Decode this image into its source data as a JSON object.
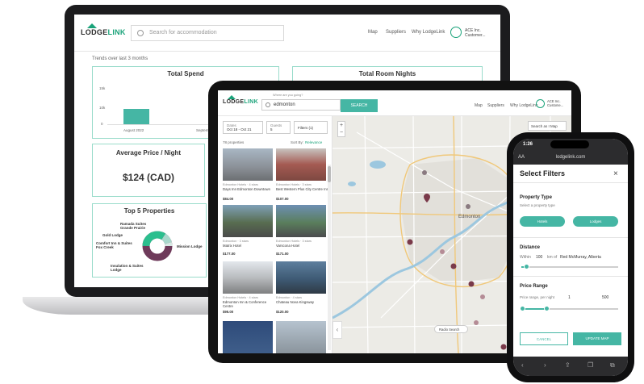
{
  "laptop": {
    "logo": {
      "lodge": "LODGE",
      "link": "LINK"
    },
    "search_placeholder": "Search for accommodation",
    "nav": [
      "Map",
      "Suppliers",
      "Why LodgeLink"
    ],
    "account": {
      "line1": "ACE Inc.",
      "line2": "Customer..."
    },
    "subtitle": "Trends over last 3 months",
    "total_spend": {
      "title": "Total Spend",
      "y_ticks": [
        "15k",
        "10k",
        "0"
      ],
      "x_labels": [
        "August 2022",
        "September 2022"
      ],
      "values": [
        15000,
        5000
      ]
    },
    "total_room_nights": {
      "title": "Total Room Nights"
    },
    "avg_price": {
      "title": "Average Price / Night",
      "value": "$124 (CAD)"
    },
    "top_properties": {
      "title": "Top 5 Properties",
      "labels": [
        "Ramada Suites Grande Prairie",
        "Gold Lodge",
        "Comfort Inn & Suites Fox Creek",
        "Mission Lodge",
        "Insulation & Suites Lodge"
      ]
    }
  },
  "tablet": {
    "logo": {
      "lodge": "LODGE",
      "link": "LINK"
    },
    "search_label": "Where are you going?",
    "search_value": "edmonton",
    "search_button": "SEARCH",
    "nav": [
      "Map",
      "Suppliers",
      "Why LodgeLink"
    ],
    "account": {
      "line1": "ACE Inc.",
      "line2": "Custome..."
    },
    "filters": {
      "dates_label": "Dates",
      "dates": "Oct 18 - Oct 21",
      "guests_label": "Guests",
      "guests": "5",
      "filter": "Filters (1)"
    },
    "results_count": "78 properties",
    "sort_label": "Sort By:",
    "sort_value": "Relevance",
    "properties": [
      {
        "meta": "Edmonton Hotels · 4 stars",
        "name": "Days Inn Edmonton Downtown",
        "price": "$84.00"
      },
      {
        "meta": "Edmonton Hotels · 3 stars",
        "name": "Best Western Plus City Centre Inn",
        "price": "$107.00"
      },
      {
        "meta": "Edmonton · 3 stars",
        "name": "Matrix Hotel",
        "price": "$177.00"
      },
      {
        "meta": "Edmonton Hotels · 3 stars",
        "name": "Varscona Hotel",
        "price": "$171.00"
      },
      {
        "meta": "Edmonton Hotels · 4 stars",
        "name": "Edmonton Inn & Conference Centre",
        "price": "$95.00"
      },
      {
        "meta": "Edmonton · 4 stars",
        "name": "Chateau Nova Kingsway",
        "price": "$120.00"
      }
    ],
    "map": {
      "toggle": "Search as I Map",
      "radio_search": "Radio Search",
      "zoom_in": "+",
      "zoom_out": "−",
      "city": "Edmonton"
    }
  },
  "phone": {
    "time": "1:26",
    "aa": "AA",
    "url": "lodgelink.com",
    "title": "Select Filters",
    "property_type": {
      "label": "Property Type",
      "sub": "Select a property type",
      "options": [
        "Hotels",
        "Lodges"
      ]
    },
    "distance": {
      "label": "Distance",
      "within": "Within",
      "value": "100",
      "of": "km of",
      "location": "Red McMurray, Alberta"
    },
    "price_range": {
      "label": "Price Range",
      "sub": "Price range, per night",
      "min": "1",
      "max": "500"
    },
    "buttons": {
      "cancel": "CANCEL",
      "update": "UPDATE MAP"
    }
  },
  "colors": {
    "brand_green": "#1aa37a",
    "accent_teal": "#45b6a4",
    "pin": "#7a3a4a"
  }
}
